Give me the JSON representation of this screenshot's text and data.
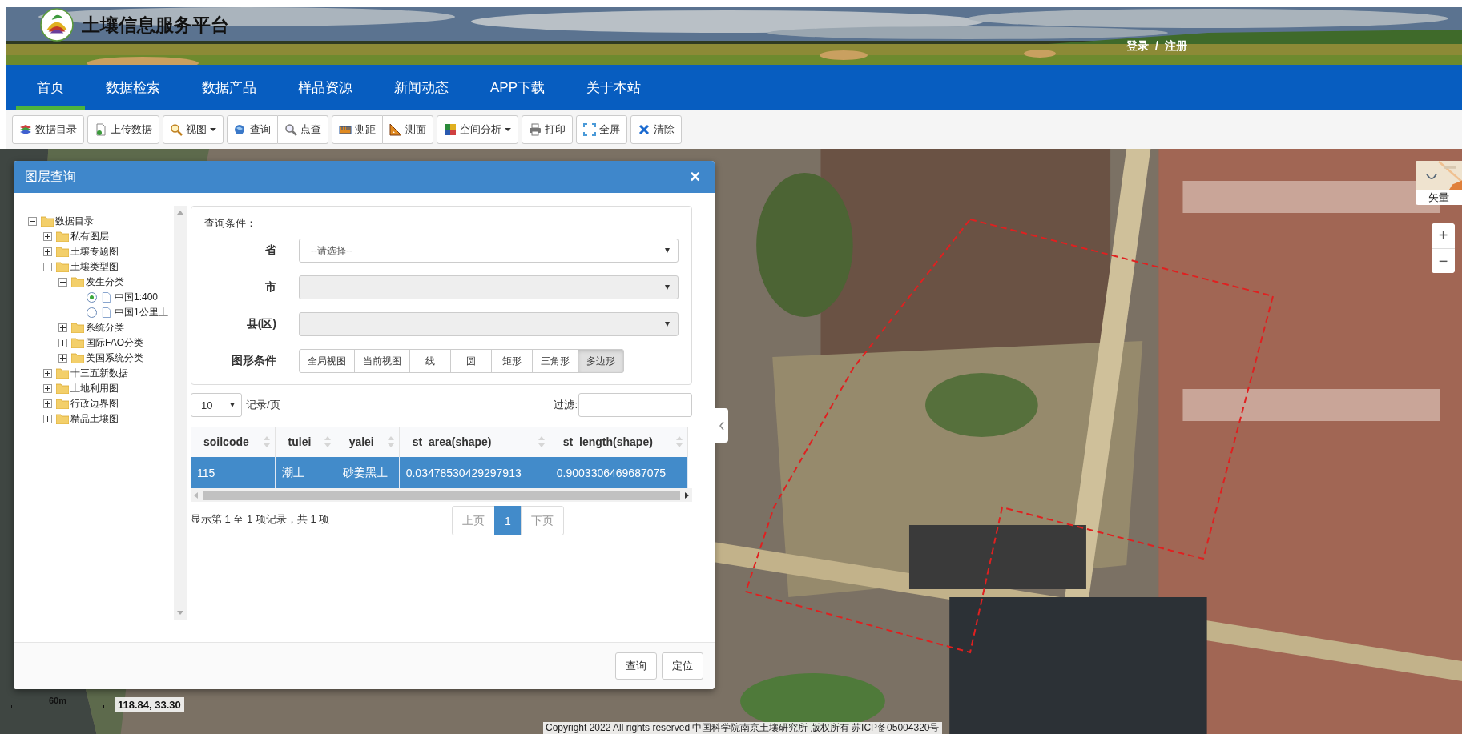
{
  "header": {
    "title": "土壤信息服务平台",
    "login": "登录",
    "separator": "/",
    "register": "注册"
  },
  "nav": [
    {
      "label": "首页",
      "selected": true
    },
    {
      "label": "数据检索",
      "selected": false
    },
    {
      "label": "数据产品",
      "selected": false
    },
    {
      "label": "样品资源",
      "selected": false
    },
    {
      "label": "新闻动态",
      "selected": false
    },
    {
      "label": "APP下载",
      "selected": false
    },
    {
      "label": "关于本站",
      "selected": false
    }
  ],
  "toolbar": [
    {
      "buttons": [
        {
          "label": "数据目录",
          "dropdown": false
        }
      ]
    },
    {
      "buttons": [
        {
          "label": "上传数据",
          "dropdown": false
        }
      ]
    },
    {
      "buttons": [
        {
          "label": "视图",
          "dropdown": true
        }
      ]
    },
    {
      "buttons": [
        {
          "label": "查询",
          "dropdown": false
        },
        {
          "label": "点查",
          "dropdown": false
        }
      ]
    },
    {
      "buttons": [
        {
          "label": "测距",
          "dropdown": false
        },
        {
          "label": "测面",
          "dropdown": false
        }
      ]
    },
    {
      "buttons": [
        {
          "label": "空间分析",
          "dropdown": true
        }
      ]
    },
    {
      "buttons": [
        {
          "label": "打印",
          "dropdown": false
        }
      ]
    },
    {
      "buttons": [
        {
          "label": "全屏",
          "dropdown": false
        }
      ]
    },
    {
      "buttons": [
        {
          "label": "清除",
          "dropdown": false
        }
      ]
    }
  ],
  "dialog": {
    "title": "图层查询",
    "close": "×",
    "tree": [
      {
        "label": "数据目录",
        "kind": "folder",
        "expanded": true,
        "children": [
          {
            "label": "私有图层",
            "kind": "folder",
            "expanded": false
          },
          {
            "label": "土壤专题图",
            "kind": "folder",
            "expanded": false
          },
          {
            "label": "土壤类型图",
            "kind": "folder",
            "expanded": true,
            "children": [
              {
                "label": "发生分类",
                "kind": "folder",
                "expanded": true,
                "children": [
                  {
                    "label": "中国1:400",
                    "kind": "layer",
                    "selected": true
                  },
                  {
                    "label": "中国1公里土",
                    "kind": "layer",
                    "selected": false
                  }
                ]
              },
              {
                "label": "系统分类",
                "kind": "folder",
                "expanded": false
              },
              {
                "label": "国际FAO分类",
                "kind": "folder",
                "expanded": false
              },
              {
                "label": "美国系统分类",
                "kind": "folder",
                "expanded": false
              }
            ]
          },
          {
            "label": "十三五新数据",
            "kind": "folder",
            "expanded": false
          },
          {
            "label": "土地利用图",
            "kind": "folder",
            "expanded": false
          },
          {
            "label": "行政边界图",
            "kind": "folder",
            "expanded": false
          },
          {
            "label": "精品土壤图",
            "kind": "folder",
            "expanded": false
          }
        ]
      }
    ],
    "conditions": {
      "title": "查询条件：",
      "fields": [
        {
          "label": "省",
          "value": "--请选择--",
          "disabled": false
        },
        {
          "label": "市",
          "disabled": true
        },
        {
          "label": "县(区)",
          "disabled": true
        }
      ],
      "shape_label": "图形条件",
      "shapes": [
        {
          "label": "全局视图",
          "selected": false
        },
        {
          "label": "当前视图",
          "selected": false
        },
        {
          "label": "线",
          "selected": false
        },
        {
          "label": "圆",
          "selected": false
        },
        {
          "label": "矩形",
          "selected": false
        },
        {
          "label": "三角形",
          "selected": false
        },
        {
          "label": "多边形",
          "selected": true
        }
      ]
    },
    "table": {
      "page_size": "10",
      "page_size_label": "记录/页",
      "filter_label": "过滤:",
      "columns": [
        "soilcode",
        "tulei",
        "yalei",
        "st_area(shape)",
        "st_length(shape)"
      ],
      "rows": [
        {
          "cells": [
            "115",
            "潮土",
            "砂姜黑土",
            "0.03478530429297913",
            "0.9003306469687075"
          ],
          "selected": true
        }
      ],
      "info": "显示第 1 至 1 项记录，共 1 项",
      "prev": "上页",
      "pages": [
        {
          "label": "1",
          "selected": true
        }
      ],
      "next": "下页"
    },
    "buttons": [
      "查询",
      "定位"
    ]
  },
  "map": {
    "layer_label": "矢量",
    "zoom_in": "+",
    "zoom_out": "−",
    "scale": "60m",
    "coordinates": "118.84, 33.30",
    "copyright": "Copyright 2022 All rights reserved 中国科学院南京土壤研究所 版权所有 苏ICP备05004320号"
  }
}
